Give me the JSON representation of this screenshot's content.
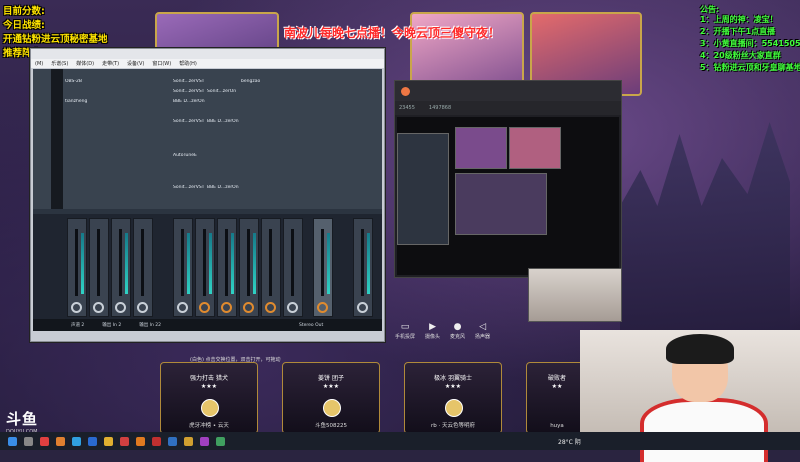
{
  "overlay": {
    "left_lines": [
      "目前分数:",
      "今日战绩:",
      "开通钻粉进云顶秘密基地",
      "推荐阵容:"
    ],
    "red_banner": "南波儿每晚七点播！今晚云顶三傻守夜！",
    "notice_title": "公告:",
    "notices": [
      "1：上周的神：凌宝！",
      "2：开播下午1点直播",
      "3：小黄直播间：5541505",
      "4：20级粉丝大家直群",
      "5：钻粉进云顶和牙皇聊基地"
    ]
  },
  "daw": {
    "title": "",
    "menus": [
      "(M)",
      "乐谱(S)",
      "媒体(D)",
      "走带(T)",
      "设备(V)",
      "窗口(W)",
      "帮助(H)"
    ],
    "rack_slots": [
      "OBS-2B",
      "tianzheng",
      "Sonit...zerVST",
      "bengzao",
      "Sonit...zerVST",
      "Sonit...zerOn",
      "BBE D...zerOn",
      "Sonit...zerVST",
      "BBE D...zerOn",
      "AutoTuneE",
      "Sonit...zerVST",
      "BBE D...zerOn"
    ],
    "mixer_labels": [
      "声道 2",
      "输出 In 2",
      "输出 In 22",
      "Stereo Out"
    ]
  },
  "obs": {
    "stats": [
      "23455",
      "1497868"
    ],
    "tabs": [
      "手机投屏",
      "摄像头",
      "麦克风",
      "扬声器"
    ]
  },
  "bottom_hint": "(白色) 点击交换位置，双击打开，可拖动",
  "shop_cards": [
    {
      "name": "强力打击 猎犬",
      "stars": "★★★",
      "sub": "虎牙冲榜 • 云天"
    },
    {
      "name": "姜饼 团子",
      "stars": "★★★",
      "sub": "斗鱼508225"
    },
    {
      "name": "极冰 羽翼骑士",
      "stars": "★★★",
      "sub": "rb · 天云色等明府"
    },
    {
      "name": "破败者",
      "stars": "★★",
      "sub": "huya"
    }
  ],
  "logo": {
    "main": "斗鱼",
    "sub": "DOUYU.COM"
  },
  "weather": "28°C 阴",
  "colors": {
    "overlay_yellow": "#ffe400",
    "banner_red": "#ff2a2a",
    "notice_green": "#40ff3a",
    "card_gold": "#c9a64a"
  }
}
